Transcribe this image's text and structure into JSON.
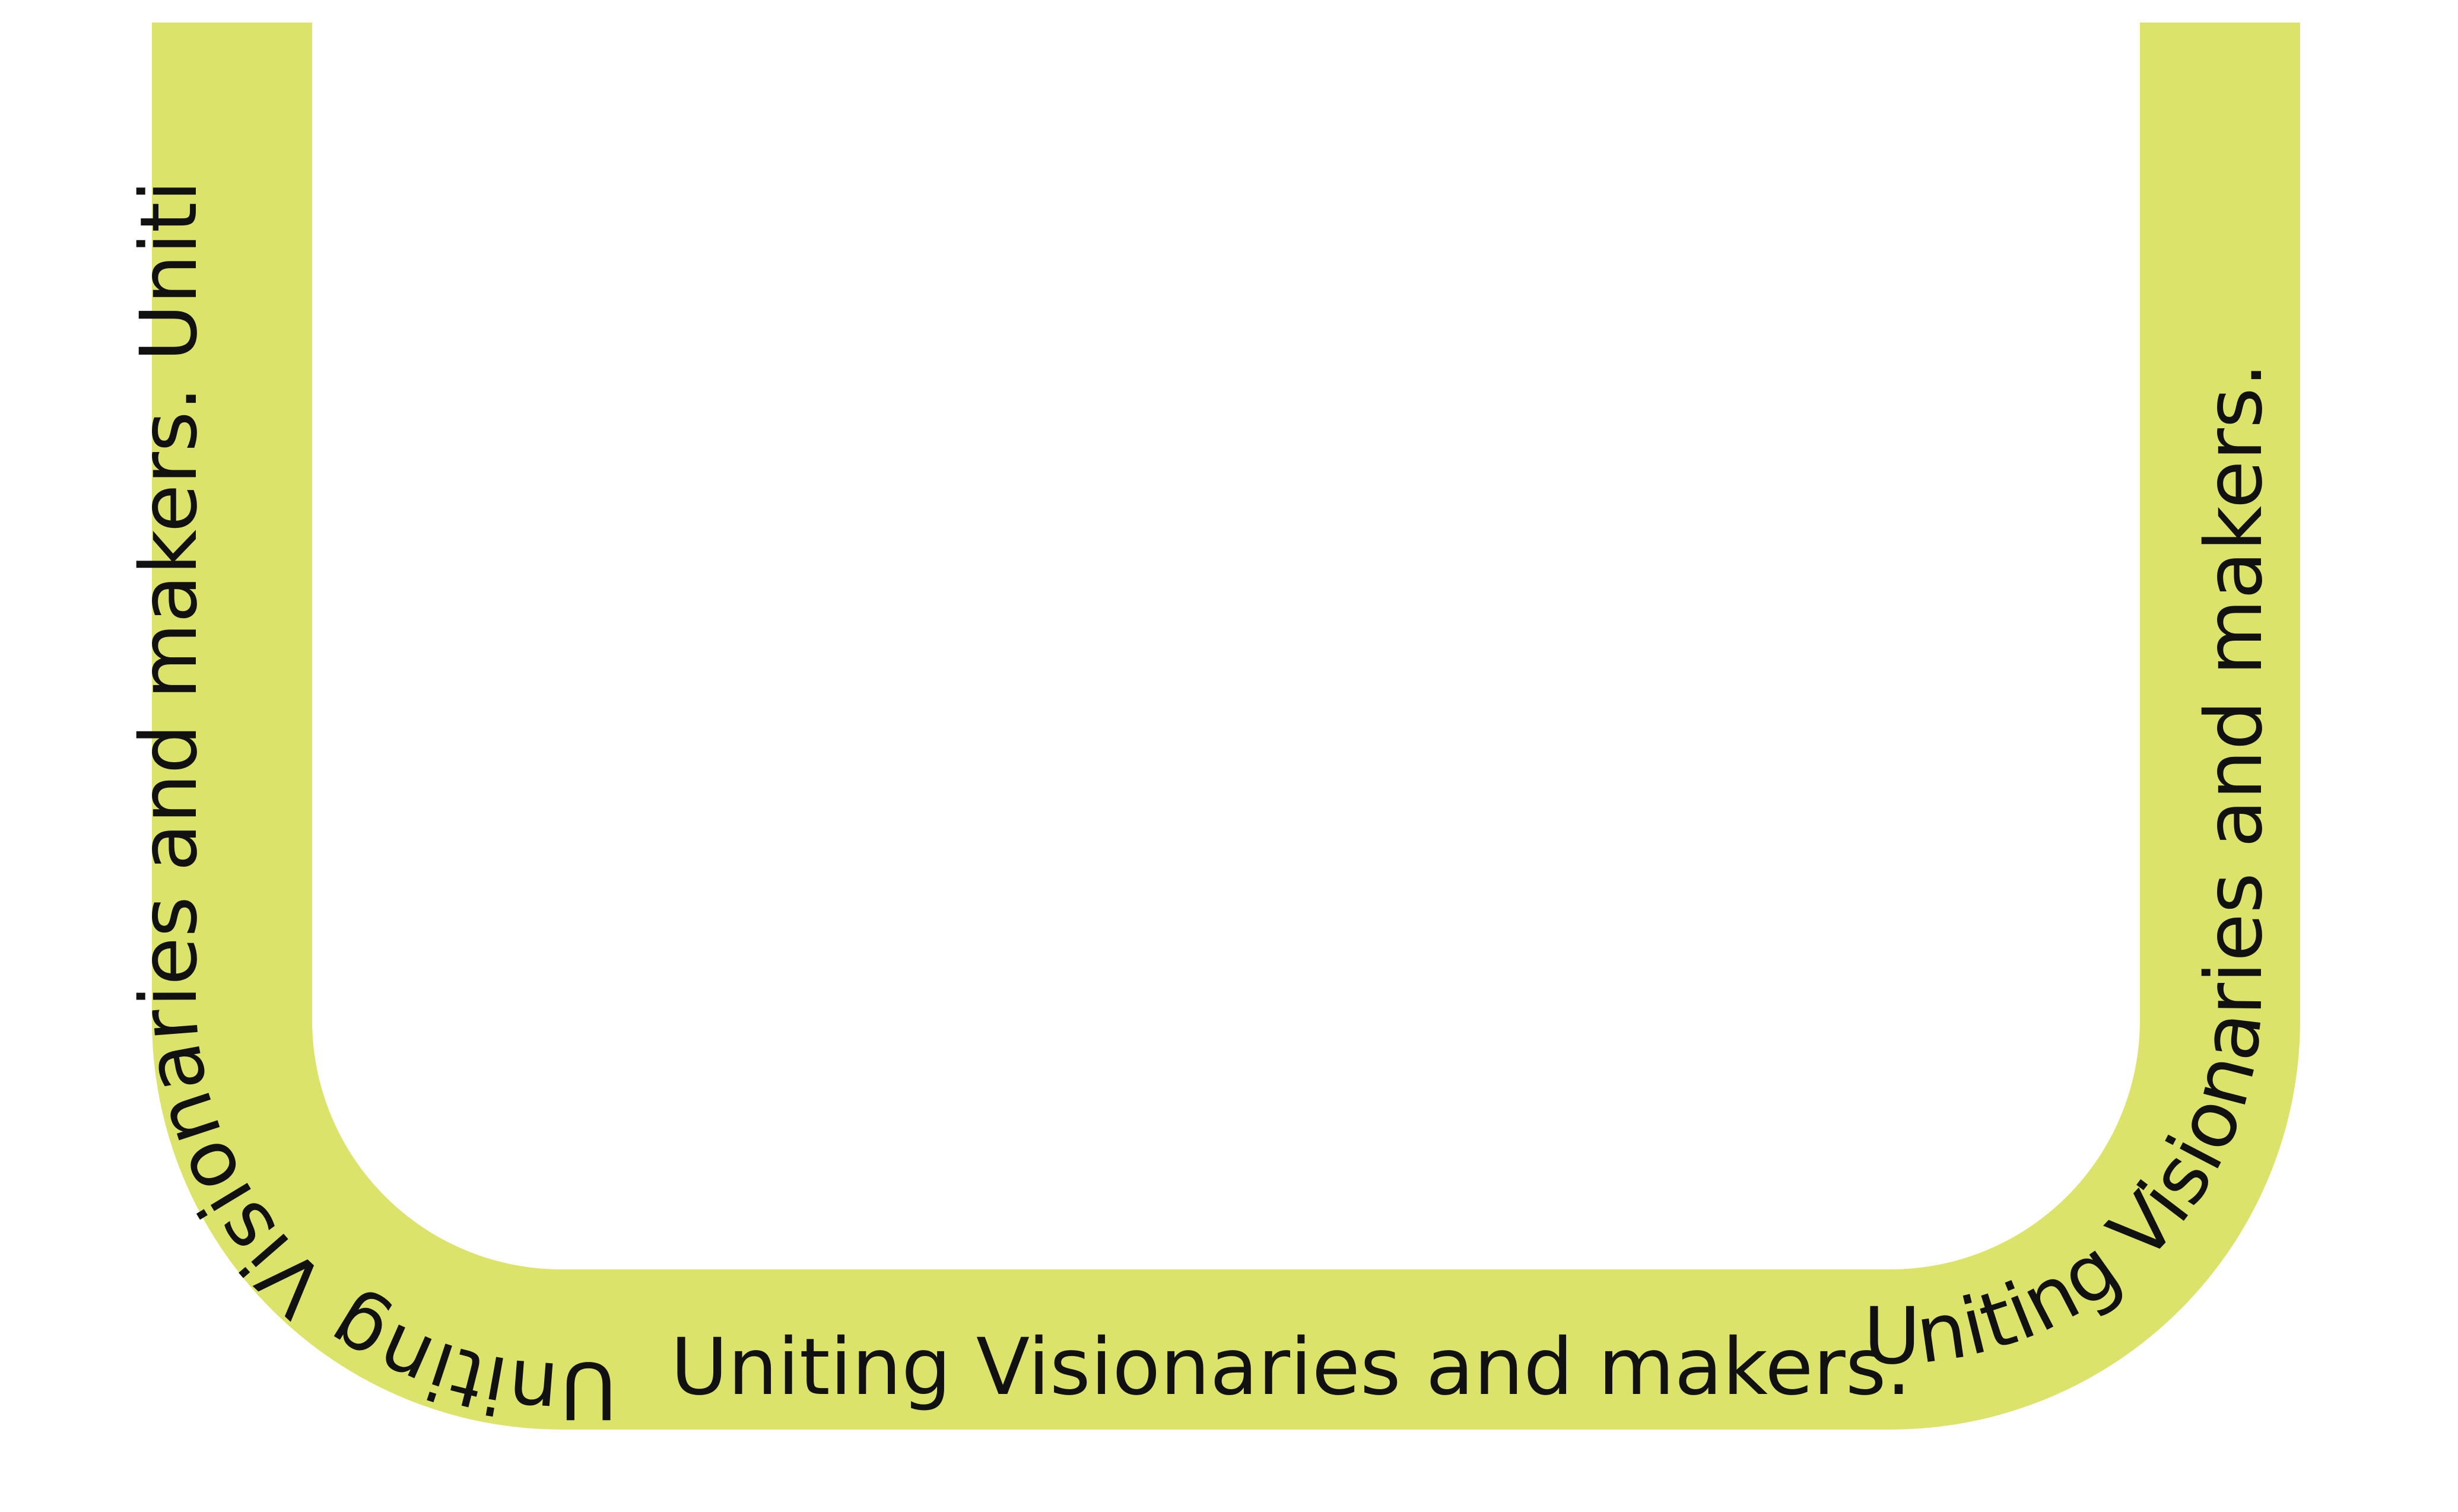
{
  "banner": {
    "text": "Uniting Visionaries and makers.",
    "left_arm_text": "Uniting Visionaries and makers. Uniti",
    "right_arm_text": "Uniting Visionaries and makers.",
    "band_color": "#dbe36a",
    "text_color": "#111111",
    "background_color": "#ffffff"
  }
}
